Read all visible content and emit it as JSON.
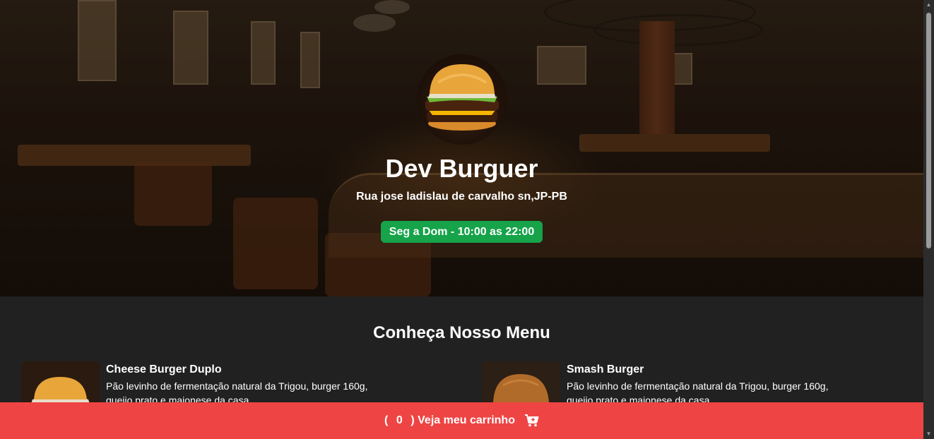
{
  "hero": {
    "logo_icon": "burger-logo-icon",
    "title": "Dev Burguer",
    "address": "Rua jose ladislau de carvalho sn,JP-PB",
    "hours": "Seg a Dom - 10:00 as 22:00"
  },
  "menu": {
    "title": "Conheça Nosso Menu",
    "items": [
      {
        "name": "Cheese Burger Duplo",
        "description": "Pão levinho de fermentação natural da Trigou, burger 160g, queijo prato e maionese da casa",
        "image_icon": "cheese-burger-image"
      },
      {
        "name": "Smash Burger",
        "description": "Pão levinho de fermentação natural da Trigou, burger 160g, queijo prato e maionese da casa",
        "image_icon": "smash-burger-image"
      }
    ]
  },
  "cart": {
    "open_paren": "(",
    "count": "0",
    "label": ") Veja meu carrinho",
    "icon": "cart-icon"
  },
  "colors": {
    "page_bg": "#212121",
    "hours_badge": "#16a34a",
    "cart_bar": "#ef4444"
  }
}
